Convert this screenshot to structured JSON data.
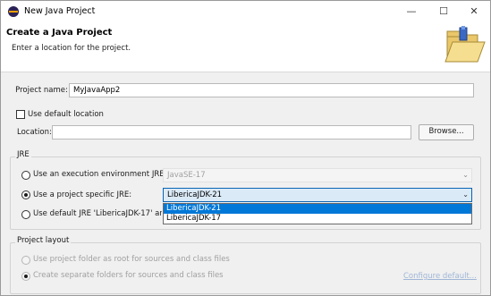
{
  "window": {
    "title": "New Java Project",
    "controls": {
      "minimize": "—",
      "maximize": "☐",
      "close": "✕"
    }
  },
  "header": {
    "title": "Create a Java Project",
    "description": "Enter a location for the project."
  },
  "project_name": {
    "label": "Project name:",
    "value": "MyJavaApp2"
  },
  "location": {
    "use_default_label": "Use default location",
    "use_default_checked": false,
    "label": "Location:",
    "value": "",
    "browse_label": "Browse..."
  },
  "jre": {
    "group_title": "JRE",
    "execution_env": {
      "label": "Use an execution environment JRE:",
      "value": "JavaSE-17"
    },
    "project_specific": {
      "label": "Use a project specific JRE:",
      "value": "LibericaJDK-21",
      "checked": true
    },
    "default_jre": {
      "label": "Use default JRE 'LibericaJDK-17' and w"
    },
    "dropdown_options": [
      "LibericaJDK-21",
      "LibericaJDK-17"
    ],
    "dropdown_selected_index": 0
  },
  "project_layout": {
    "group_title": "Project layout",
    "option_root": "Use project folder as root for sources and class files",
    "option_separate": "Create separate folders for sources and class files",
    "configure_link": "Configure default..."
  },
  "colors": {
    "selection": "#0078d7",
    "active_combo_border": "#0a64b4",
    "active_combo_bg": "#dbeaf7",
    "disabled_text": "#a0a0a0",
    "link_disabled": "#9fb6d6"
  }
}
